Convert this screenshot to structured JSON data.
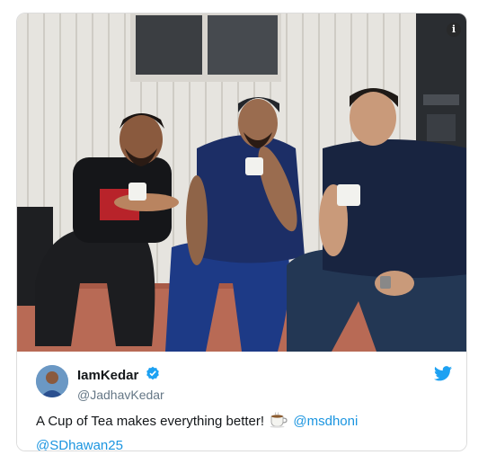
{
  "photo": {
    "alt": "Three cricketers sitting outside holding cups of tea",
    "info_icon": "info-icon"
  },
  "tweet": {
    "display_name": "IamKedar",
    "handle": "@JadhavKedar",
    "text_main": "A Cup of Tea makes everything better!",
    "emoji": "tea-cup-icon",
    "mentions": [
      "@msdhoni",
      "@SDhawan25"
    ],
    "verified_icon": "verified-badge-icon",
    "brand_icon": "twitter-bird-icon"
  },
  "colors": {
    "accent": "#1da1f2",
    "mention": "#1b95e0",
    "text": "#14171a",
    "secondary": "#657786"
  }
}
